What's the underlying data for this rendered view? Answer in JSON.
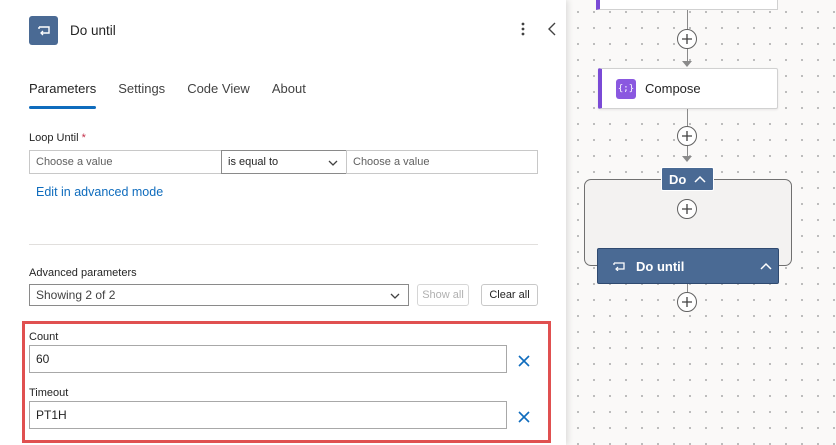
{
  "panel": {
    "title": "Do until",
    "tabs": [
      {
        "label": "Parameters",
        "active": true
      },
      {
        "label": "Settings",
        "active": false
      },
      {
        "label": "Code View",
        "active": false
      },
      {
        "label": "About",
        "active": false
      }
    ],
    "loop_until": {
      "label": "Loop Until",
      "required_mark": "*",
      "left_placeholder": "Choose a value",
      "operator": "is equal to",
      "right_placeholder": "Choose a value"
    },
    "advanced_mode_link": "Edit in advanced mode",
    "advanced": {
      "label": "Advanced parameters",
      "selected": "Showing 2 of 2",
      "show_all": "Show all",
      "clear_all": "Clear all"
    },
    "count": {
      "label": "Count",
      "value": "60"
    },
    "timeout": {
      "label": "Timeout",
      "value": "PT1H"
    }
  },
  "canvas": {
    "compose_label": "Compose",
    "compose_icon_text": "{;}",
    "do_label": "Do",
    "do_until_label": "Do until"
  },
  "colors": {
    "accent": "#0f6cbd",
    "loop_action": "#4a6a94",
    "compose": "#8a58e0",
    "highlight": "#e05050"
  }
}
